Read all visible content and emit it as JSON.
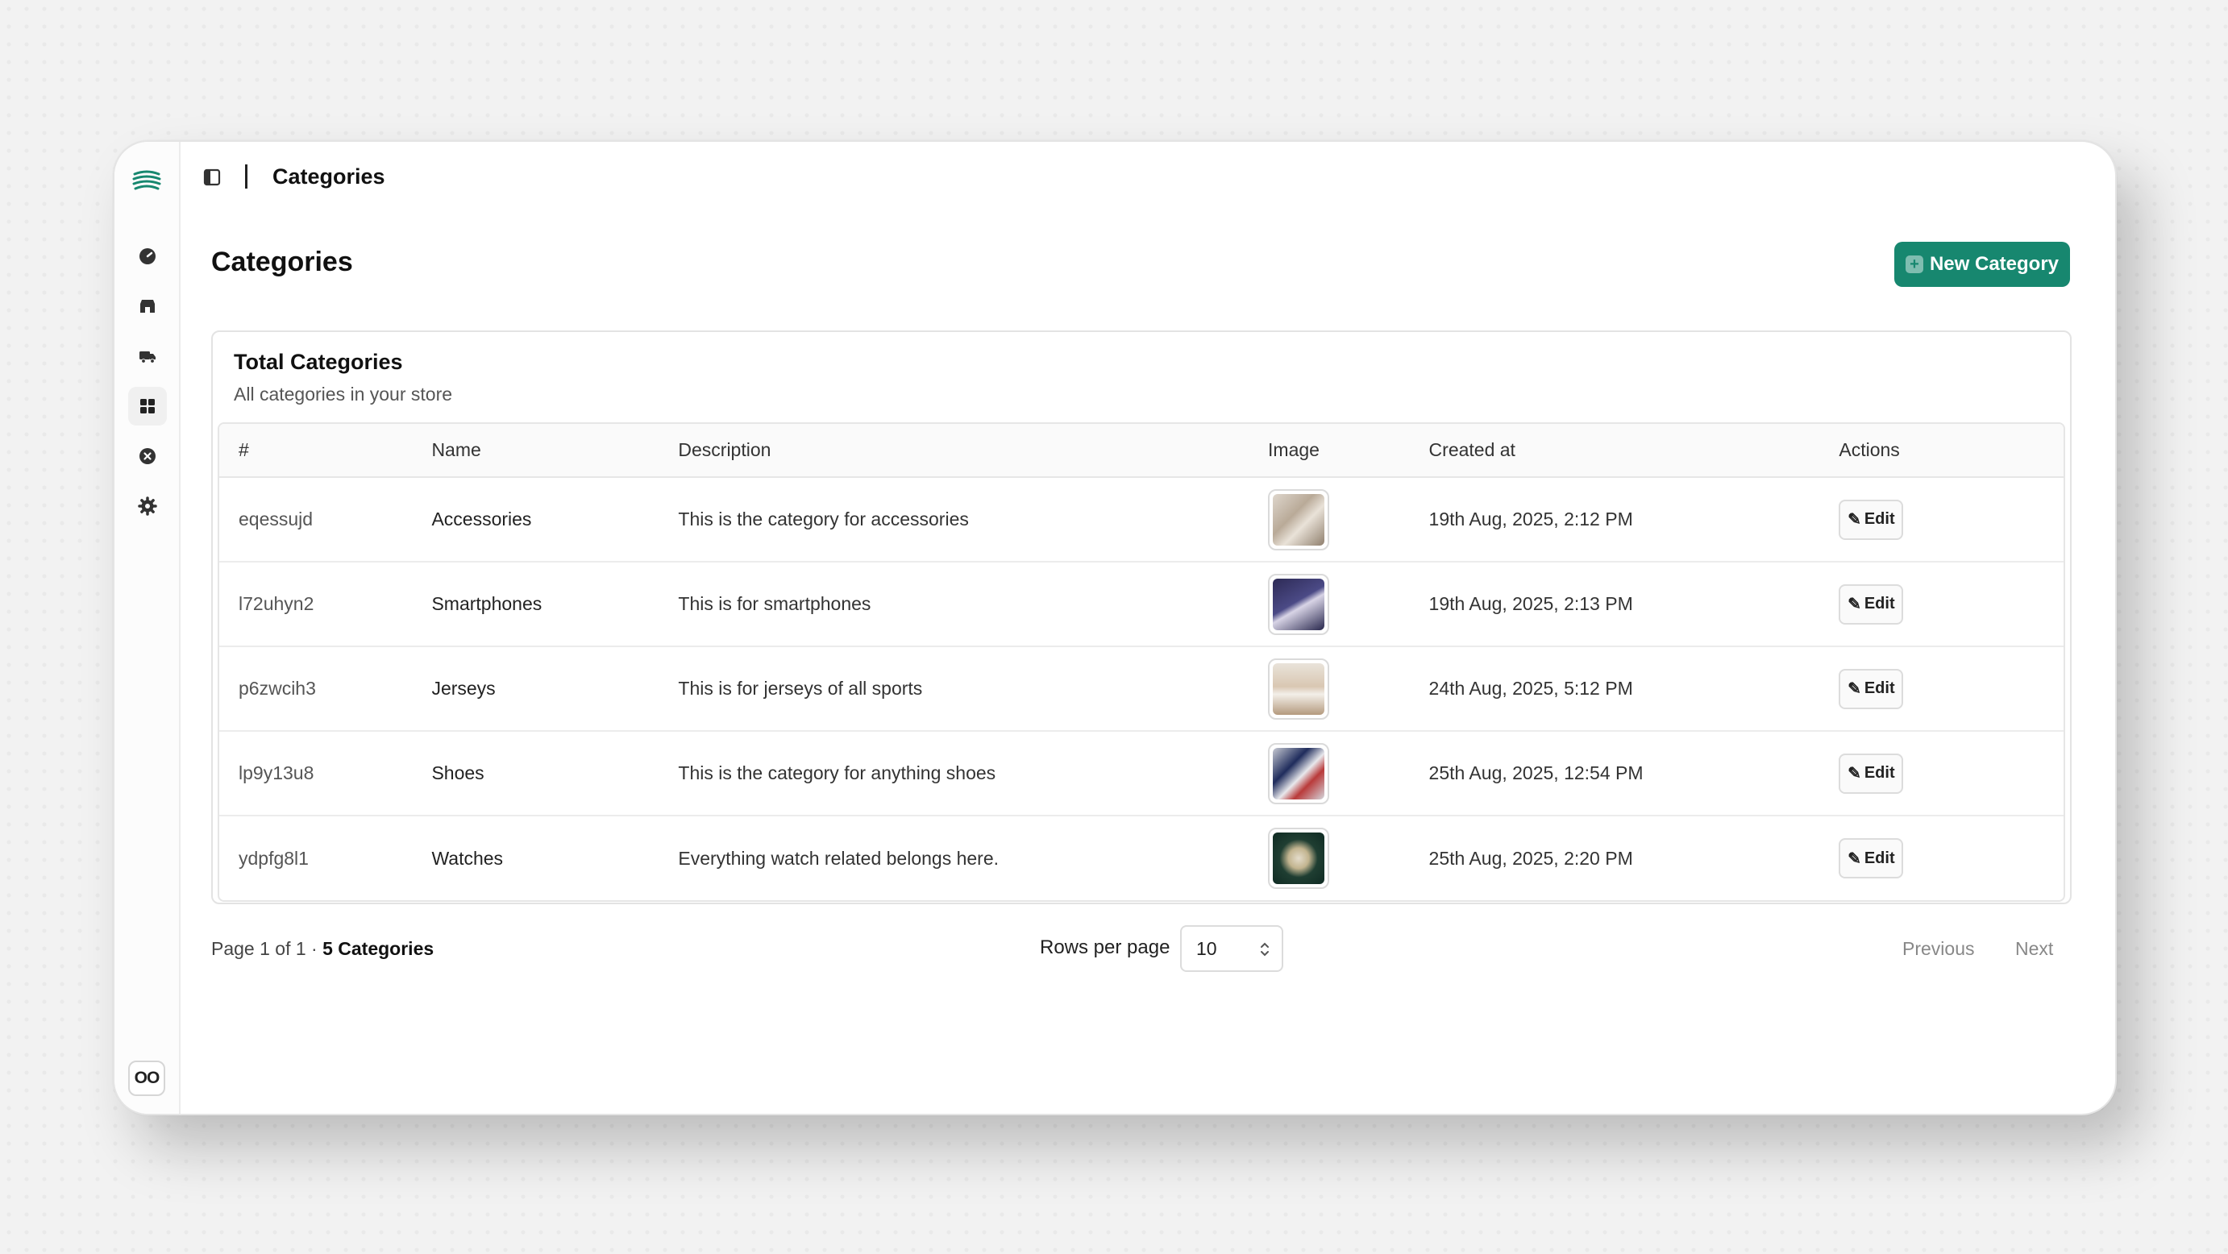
{
  "header": {
    "breadcrumb": "Categories"
  },
  "page": {
    "title": "Categories",
    "new_button_label": "New Category",
    "accent": "#17876f"
  },
  "card": {
    "title": "Total Categories",
    "subtitle": "All categories in your store"
  },
  "table": {
    "columns": [
      "#",
      "Name",
      "Description",
      "Image",
      "Created at",
      "Actions"
    ],
    "rows": [
      {
        "id": "eqessujd",
        "name": "Accessories",
        "description": "This is the category for accessories",
        "created": "19th Aug, 2025, 2:12 PM",
        "action": "Edit"
      },
      {
        "id": "l72uhyn2",
        "name": "Smartphones",
        "description": "This is for smartphones",
        "created": "19th Aug, 2025, 2:13 PM",
        "action": "Edit"
      },
      {
        "id": "p6zwcih3",
        "name": "Jerseys",
        "description": "This is for jerseys of all sports",
        "created": "24th Aug, 2025, 5:12 PM",
        "action": "Edit"
      },
      {
        "id": "lp9y13u8",
        "name": "Shoes",
        "description": "This is the category for anything shoes",
        "created": "25th Aug, 2025, 12:54 PM",
        "action": "Edit"
      },
      {
        "id": "ydpfg8l1",
        "name": "Watches",
        "description": "Everything watch related belongs here.",
        "created": "25th Aug, 2025, 2:20 PM",
        "action": "Edit"
      }
    ]
  },
  "footer": {
    "page_info": "Page 1 of 1 · ",
    "count": "5 Categories",
    "rows_label": "Rows per page",
    "rows_value": "10",
    "previous": "Previous",
    "next": "Next"
  },
  "sidebar": {
    "badge": "OO"
  }
}
